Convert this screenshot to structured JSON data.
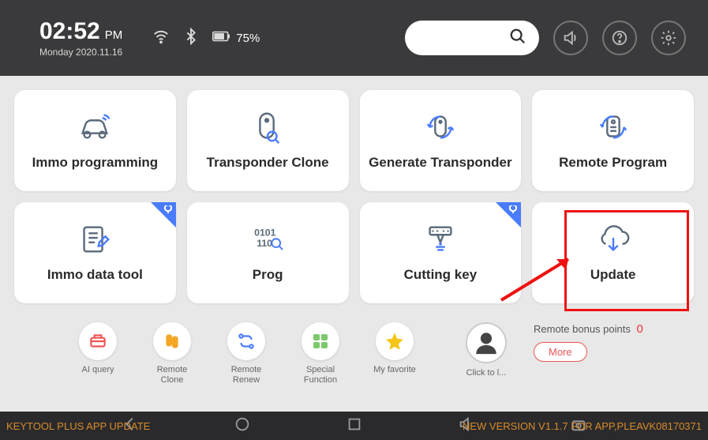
{
  "app_version": "V1.1.7",
  "clock": {
    "time": "02:52",
    "ampm": "PM",
    "date": "Monday 2020.11.16"
  },
  "battery": "75%",
  "tiles": [
    {
      "label": "Immo programming"
    },
    {
      "label": "Transponder Clone"
    },
    {
      "label": "Generate Transponder"
    },
    {
      "label": "Remote Program"
    },
    {
      "label": "Immo data tool"
    },
    {
      "label": "Prog"
    },
    {
      "label": "Cutting key"
    },
    {
      "label": "Update"
    }
  ],
  "shortcuts": [
    {
      "label": "AI query"
    },
    {
      "label": "Remote Clone"
    },
    {
      "label": "Remote Renew"
    },
    {
      "label": "Special Function"
    },
    {
      "label": "My favorite"
    }
  ],
  "avatar_label": "Click to l...",
  "bonus_label": "Remote bonus points",
  "bonus_count": "0",
  "more_label": "More",
  "ticker_left": "KEYTOOL PLUS APP UPDATE",
  "ticker_right_text": "NEW VERSION V1.1.7 FOR APP,PLEA",
  "ticker_serial": "VK08170371"
}
